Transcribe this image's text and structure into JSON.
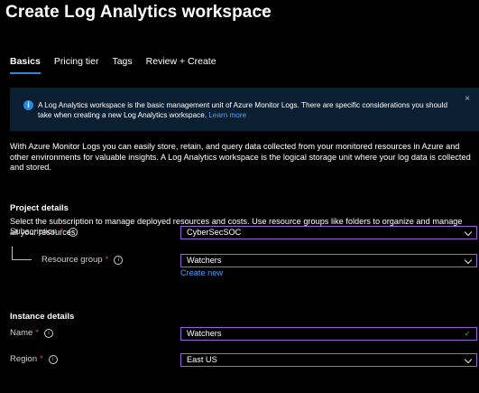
{
  "header": {
    "title": "Create Log Analytics workspace",
    "more": "···"
  },
  "tabs": [
    {
      "label": "Basics",
      "active": true
    },
    {
      "label": "Pricing tier",
      "active": false
    },
    {
      "label": "Tags",
      "active": false
    },
    {
      "label": "Review + Create",
      "active": false
    }
  ],
  "info": {
    "text": "A Log Analytics workspace is the basic management unit of Azure Monitor Logs. There are specific considerations you should take when creating a new Log Analytics workspace.",
    "link": "Learn more",
    "close": "×"
  },
  "description": "With Azure Monitor Logs you can easily store, retain, and query data collected from your monitored resources in Azure and other environments for valuable insights. A Log Analytics workspace is the logical storage unit where your log data is collected and stored.",
  "project": {
    "title": "Project details",
    "desc": "Select the subscription to manage deployed resources and costs. Use resource groups like folders to organize and manage all your resources.",
    "subscription_label": "Subscription",
    "subscription_value": "CyberSecSOC",
    "rg_label": "Resource group",
    "rg_value": "Watchers",
    "create_new": "Create new"
  },
  "instance": {
    "title": "Instance details",
    "name_label": "Name",
    "name_value": "Watchers",
    "region_label": "Region",
    "region_value": "East US"
  },
  "required_marker": "*",
  "info_glyph": "i",
  "colors": {
    "accent": "#2b88d8",
    "field_border": "#9b62d8",
    "link": "#4aa0ff",
    "required": "#e74856",
    "valid": "#57a300"
  }
}
